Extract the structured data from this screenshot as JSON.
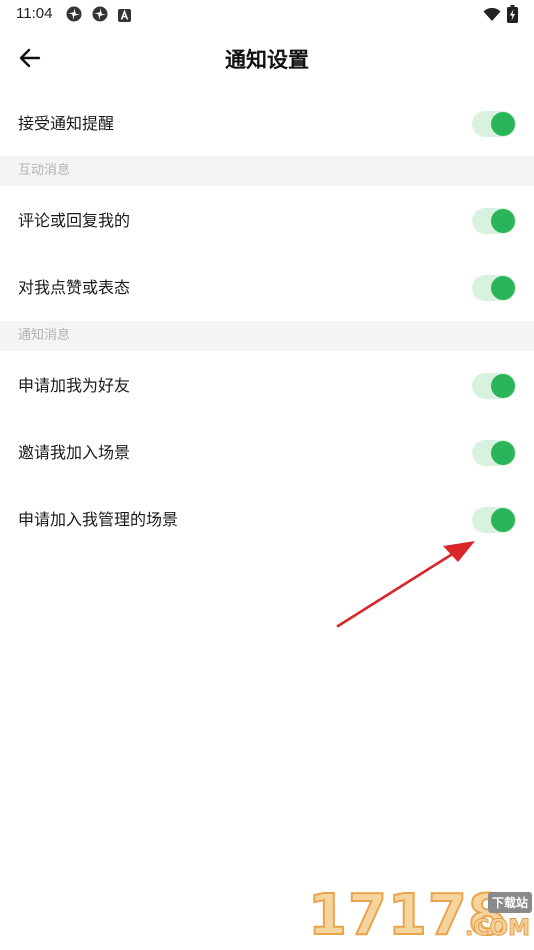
{
  "status_bar": {
    "time": "11:04",
    "left_icons": [
      "pinwheel-icon",
      "pinwheel-icon",
      "text-a-icon"
    ],
    "right_icons": [
      "wifi-icon",
      "battery-charging-icon"
    ]
  },
  "header": {
    "back_icon": "arrow-left-icon",
    "title": "通知设置"
  },
  "settings": {
    "master": {
      "label": "接受通知提醒",
      "enabled": true
    },
    "interaction_section": {
      "title": "互动消息",
      "items": [
        {
          "label": "评论或回复我的",
          "enabled": true
        },
        {
          "label": "对我点赞或表态",
          "enabled": true
        }
      ]
    },
    "notification_section": {
      "title": "通知消息",
      "items": [
        {
          "label": "申请加我为好友",
          "enabled": true
        },
        {
          "label": "邀请我加入场景",
          "enabled": true
        },
        {
          "label": "申请加入我管理的场景",
          "enabled": true
        }
      ]
    }
  },
  "watermark": {
    "digits": "17178",
    "badge": "下载站",
    "domain": ".COM"
  },
  "colors": {
    "toggle_on_track": "#d8f2df",
    "toggle_on_knob": "#2ab55a",
    "section_bg": "#f4f4f4",
    "section_text": "#b3b3b3",
    "annotation_arrow": "#d9262b"
  }
}
